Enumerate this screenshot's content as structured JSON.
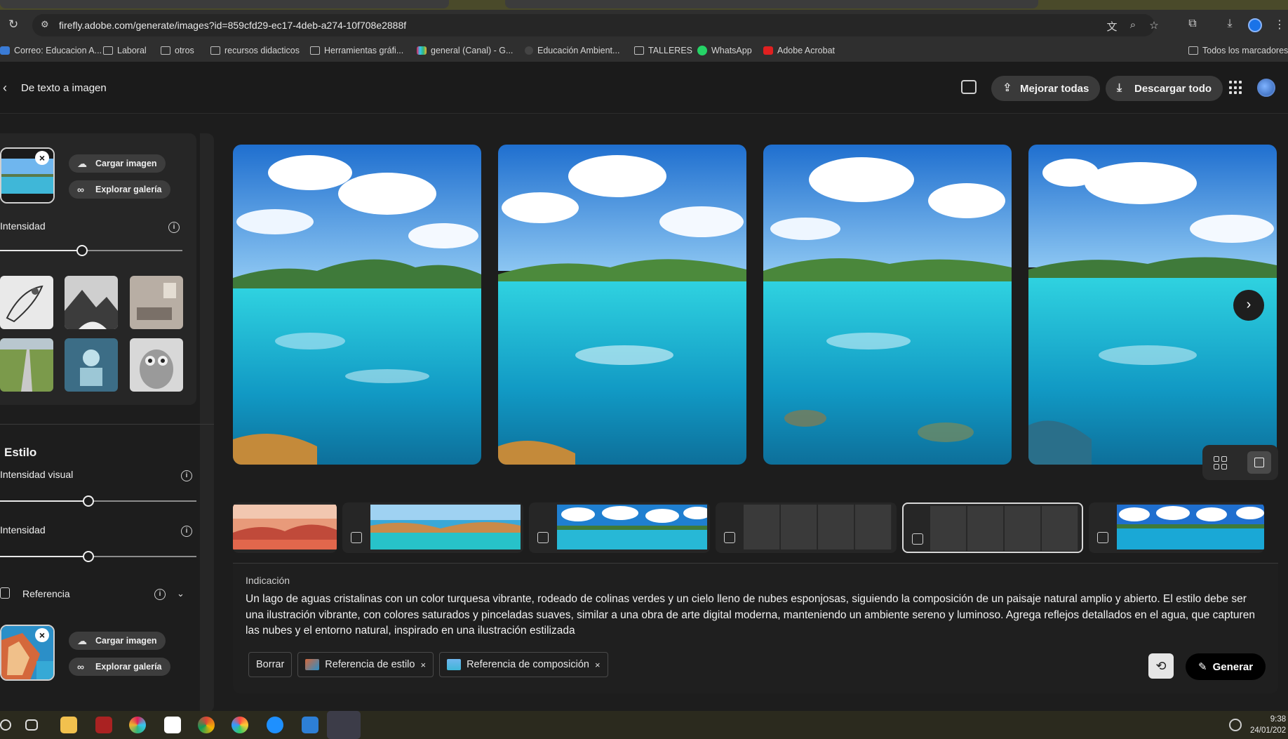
{
  "browser": {
    "url": "firefly.adobe.com/generate/images?id=859cfd29-ec17-4deb-a274-10f708e2888f",
    "bookmarks": [
      "Correo: Educacion A...",
      "Laboral",
      "otros",
      "recursos didacticos",
      "Herramientas gráfi...",
      "general (Canal) - G...",
      "Educación Ambient...",
      "TALLERES",
      "WhatsApp",
      "Adobe Acrobat"
    ],
    "all_bookmarks": "Todos los marcadores"
  },
  "header": {
    "title": "De texto a imagen",
    "enhance_all": "Mejorar todas",
    "download_all": "Descargar todo"
  },
  "left_panel": {
    "composition": {
      "upload_label": "Cargar imagen",
      "gallery_label": "Explorar galería",
      "strength_label": "Intensidad",
      "strength_value": 0.45
    },
    "style": {
      "title": "Estilo",
      "visual_intensity_label": "Intensidad visual",
      "visual_intensity_value": 0.45,
      "strength_label": "Intensidad",
      "strength_value": 0.45,
      "reference_label": "Referencia",
      "upload_label": "Cargar imagen",
      "gallery_label": "Explorar galería"
    }
  },
  "prompt": {
    "label": "Indicación",
    "text": "Un lago de aguas cristalinas con un color turquesa vibrante, rodeado de colinas verdes y un cielo lleno de nubes esponjosas, siguiendo la composición de un paisaje natural amplio y abierto. El estilo debe ser una ilustración vibrante, con colores saturados y pinceladas suaves, similar a una obra de arte digital moderna, manteniendo un ambiente sereno y luminoso. Agrega reflejos detallados en el agua, que capturen las nubes y el entorno natural, inspirado en una ilustración estilizada",
    "clear_label": "Borrar",
    "style_ref_label": "Referencia de estilo",
    "composition_ref_label": "Referencia de composición",
    "remove_glyph": "×",
    "generate_label": "Generar"
  },
  "taskbar": {
    "time": "9:38",
    "date": "24/01/202"
  },
  "colors": {
    "background": "#1d1d1d",
    "sky": "#2f86d8",
    "water": "#1fc6d6",
    "accent_button": "#3a3a3a"
  },
  "icons": {
    "back": "chevron-left-icon",
    "next": "chevron-right-icon",
    "feedback": "comment-icon",
    "enhance": "enhance-icon",
    "download": "download-icon",
    "apps": "apps-grid-icon",
    "upload": "cloud-upload-icon",
    "gallery": "binoculars-icon",
    "info": "info-icon",
    "history": "history-icon",
    "generate": "generate-icon"
  }
}
